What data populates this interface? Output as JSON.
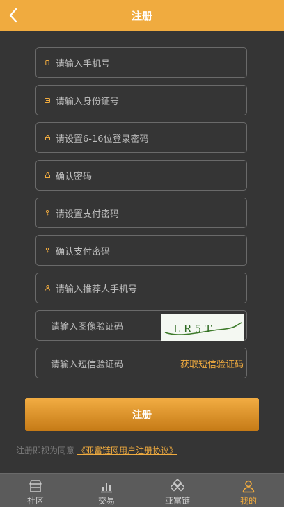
{
  "header": {
    "title": "注册"
  },
  "form": {
    "fields": [
      {
        "placeholder": "请输入手机号",
        "icon": "phone-icon"
      },
      {
        "placeholder": "请输入身份证号",
        "icon": "id-card-icon"
      },
      {
        "placeholder": "请设置6-16位登录密码",
        "icon": "lock-icon"
      },
      {
        "placeholder": "确认密码",
        "icon": "lock-icon"
      },
      {
        "placeholder": "请设置支付密码",
        "icon": "key-icon"
      },
      {
        "placeholder": "确认支付密码",
        "icon": "key-icon"
      },
      {
        "placeholder": "请输入推荐人手机号",
        "icon": "user-icon"
      }
    ],
    "image_code_placeholder": "请输入图像验证码",
    "captcha_text": "L R 5 T",
    "sms_code_placeholder": "请输入短信验证码",
    "sms_button": "获取短信验证码"
  },
  "submit_label": "注册",
  "agreement": {
    "prefix": "注册即视为同意",
    "link": "《亚富链网用户注册协议》"
  },
  "tabs": [
    {
      "label": "社区",
      "icon": "store-icon"
    },
    {
      "label": "交易",
      "icon": "bar-chart-icon"
    },
    {
      "label": "亚富链",
      "icon": "chain-icon"
    },
    {
      "label": "我的",
      "icon": "user-icon"
    }
  ],
  "colors": {
    "accent": "#f0ab3f",
    "background": "#353535",
    "tabbar": "#5b5b5b"
  }
}
